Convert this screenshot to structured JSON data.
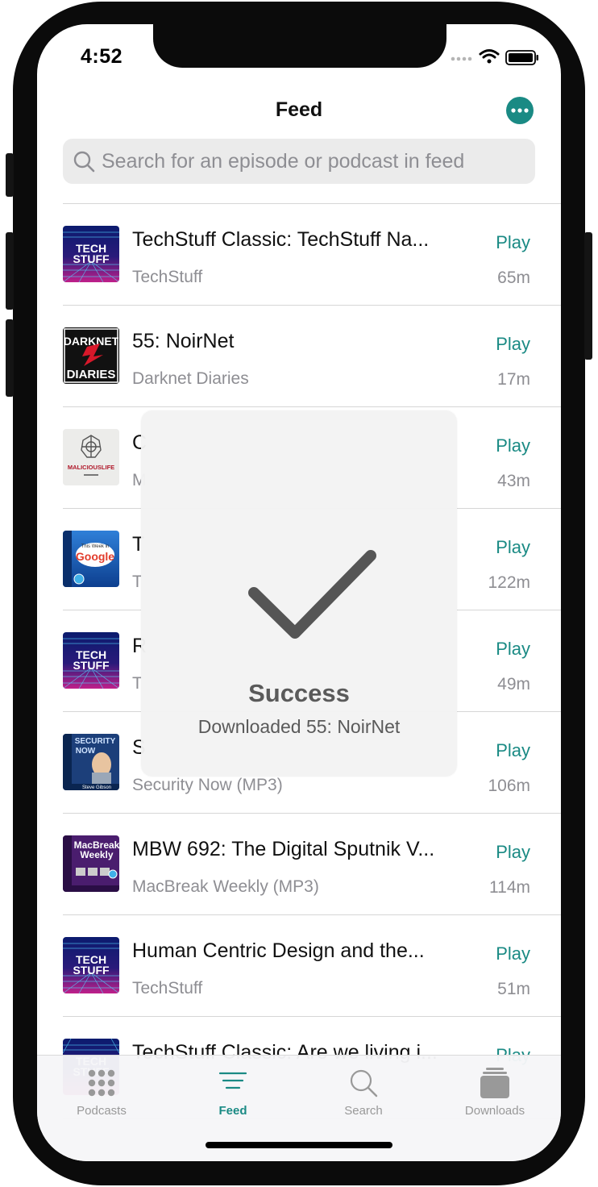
{
  "status_bar": {
    "time": "4:52"
  },
  "nav": {
    "title": "Feed"
  },
  "search": {
    "placeholder": "Search for an episode or podcast in feed"
  },
  "colors": {
    "accent": "#1a8a84",
    "secondary_text": "#8e8e93"
  },
  "episodes": [
    {
      "title": "TechStuff Classic: TechStuff Na...",
      "podcast": "TechStuff",
      "action": "Play",
      "duration": "65m",
      "art": "techstuff"
    },
    {
      "title": "55: NoirNet",
      "podcast": "Darknet Diaries",
      "action": "Play",
      "duration": "17m",
      "art": "darknet-diaries"
    },
    {
      "title": "C",
      "podcast": "M",
      "action": "Play",
      "duration": "43m",
      "art": "malicious-life"
    },
    {
      "title": "T",
      "podcast": "T",
      "action": "Play",
      "duration": "122m",
      "art": "this-week-in-google"
    },
    {
      "title": "R",
      "podcast": "T",
      "action": "Play",
      "duration": "49m",
      "art": "techstuff"
    },
    {
      "title": "S",
      "podcast": "Security Now (MP3)",
      "action": "Play",
      "duration": "106m",
      "art": "security-now"
    },
    {
      "title": "MBW 692: The Digital Sputnik V...",
      "podcast": "MacBreak Weekly (MP3)",
      "action": "Play",
      "duration": "114m",
      "art": "macbreak-weekly"
    },
    {
      "title": "Human Centric Design and the...",
      "podcast": "TechStuff",
      "action": "Play",
      "duration": "51m",
      "art": "techstuff"
    },
    {
      "title": "TechStuff Classic: Are we living i...",
      "podcast": "",
      "action": "Play",
      "duration": "",
      "art": "techstuff"
    }
  ],
  "art_text": {
    "techstuff": [
      "TECH",
      "STUFF"
    ],
    "darknet": [
      "DARKNET",
      "DIARIES"
    ],
    "malicious": "MALICIOUSLIFE",
    "twig": [
      "This Week in",
      "Google"
    ],
    "security": [
      "SECURITY",
      "NOW",
      "Steve Gibson"
    ],
    "macbreak": [
      "MacBreak",
      "Weekly"
    ]
  },
  "hud": {
    "title": "Success",
    "message": "Downloaded 55: NoirNet",
    "icon": "checkmark-icon"
  },
  "tabs": [
    {
      "label": "Podcasts",
      "icon": "grid-icon",
      "active": false
    },
    {
      "label": "Feed",
      "icon": "feed-lines-icon",
      "active": true
    },
    {
      "label": "Search",
      "icon": "search-icon",
      "active": false
    },
    {
      "label": "Downloads",
      "icon": "downloads-stack-icon",
      "active": false
    }
  ]
}
